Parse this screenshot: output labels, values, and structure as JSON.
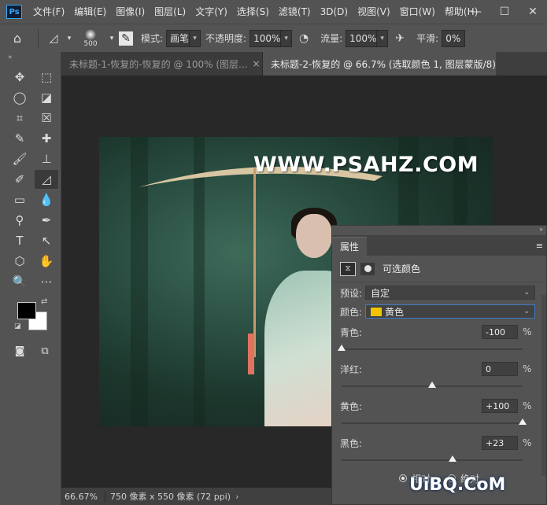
{
  "app": {
    "logo": "Ps"
  },
  "menu": [
    "文件(F)",
    "编辑(E)",
    "图像(I)",
    "图层(L)",
    "文字(Y)",
    "选择(S)",
    "滤镜(T)",
    "3D(D)",
    "视图(V)",
    "窗口(W)",
    "帮助(H)"
  ],
  "window_controls": {
    "minimize": "—",
    "restore": "☐",
    "close": "✕"
  },
  "options": {
    "brush_size": "500",
    "mode_label": "模式:",
    "mode_value": "画笔",
    "opacity_label": "不透明度:",
    "opacity_value": "100%",
    "flow_label": "流量:",
    "flow_value": "100%",
    "smooth_label": "平滑:",
    "smooth_value": "0%"
  },
  "tabs": [
    {
      "label": "未标题-1-恢复的-恢复的 @ 100% (图层...",
      "close": "×"
    },
    {
      "label": "未标题-2-恢复的 @ 66.7% (选取颜色 1, 图层蒙版/8) *",
      "close": "×"
    }
  ],
  "toolbar": {
    "collapse": "«",
    "tools": [
      "✥",
      "⬚",
      "◯",
      "◪",
      "⌗",
      "☒",
      "✎",
      "✚",
      "🖌",
      "⊥",
      "✐",
      "◿",
      "▭",
      "💧",
      "⚲",
      "✒",
      "T",
      "↖",
      "⬡",
      "✋",
      "🔍",
      "⋯"
    ]
  },
  "canvas": {
    "watermark": "WWW.PSAHZ.COM"
  },
  "status": {
    "zoom": "66.67%",
    "doc_info": "750 像素 x 550 像素 (72 ppi)",
    "arrow": "›"
  },
  "properties": {
    "tab": "属性",
    "menu_icon": "≡",
    "title": "可选颜色",
    "preset_label": "预设:",
    "preset_value": "自定",
    "color_label": "颜色:",
    "color_value": "黄色",
    "swatch_color": "#f2c400",
    "sliders": [
      {
        "name": "青色:",
        "value": "-100",
        "unit": "%",
        "level": 0.0
      },
      {
        "name": "洋红:",
        "value": "0",
        "unit": "%",
        "level": 0.5
      },
      {
        "name": "黄色:",
        "value": "+100",
        "unit": "%",
        "level": 1.0
      },
      {
        "name": "黑色:",
        "value": "+23",
        "unit": "%",
        "level": 0.615
      }
    ],
    "method_relative": "相对",
    "method_absolute": "绝对"
  },
  "corner_watermark": "UiBQ.CoM"
}
